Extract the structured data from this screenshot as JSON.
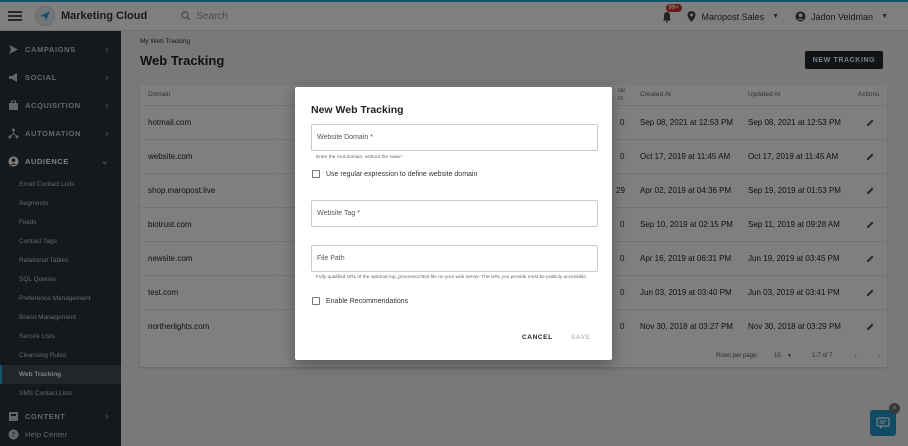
{
  "app": {
    "name": "Marketing Cloud"
  },
  "search": {
    "placeholder": "Search"
  },
  "header": {
    "notification_count": "99+",
    "account": "Maropost Sales",
    "user": "Jadon Veldman"
  },
  "sidebar": {
    "nav": [
      {
        "label": "CAMPAIGNS",
        "icon": "send-icon"
      },
      {
        "label": "SOCIAL",
        "icon": "megaphone-icon"
      },
      {
        "label": "ACQUISITION",
        "icon": "briefcase-icon"
      },
      {
        "label": "AUTOMATION",
        "icon": "flow-icon"
      },
      {
        "label": "AUDIENCE",
        "icon": "person-icon"
      }
    ],
    "audience_items": [
      "Email Contact Lists",
      "Segments",
      "Fields",
      "Contact Tags",
      "Relational Tables",
      "SQL Queries",
      "Preference Management",
      "Brand Management",
      "Secure Lists",
      "Cleansing Rules",
      "Web Tracking",
      "SMS Contact Lists"
    ],
    "active_item": "Web Tracking",
    "content_label": "CONTENT",
    "help_label": "Help Center"
  },
  "page": {
    "breadcrumb": "My Web Tracking",
    "title": "Web Tracking",
    "new_button": "NEW TRACKING"
  },
  "table": {
    "headers": {
      "domain": "Domain",
      "visitors": "tal\nrs",
      "created": "Created At",
      "updated": "Updated At",
      "actions": "Actions"
    },
    "rows": [
      {
        "domain": "hotmail.com",
        "count": "0",
        "created": "Sep 08, 2021 at 12:53 PM",
        "updated": "Sep 08, 2021 at 12:53 PM"
      },
      {
        "domain": "website.com",
        "count": "0",
        "created": "Oct 17, 2019 at 11:45 AM",
        "updated": "Oct 17, 2019 at 11:45 AM"
      },
      {
        "domain": "shop.maropost.live",
        "count": "29",
        "created": "Apr 02, 2019 at 04:36 PM",
        "updated": "Sep 19, 2019 at 01:53 PM"
      },
      {
        "domain": "biotrust.com",
        "count": "0",
        "created": "Sep 10, 2019 at 02:15 PM",
        "updated": "Sep 11, 2019 at 09:28 AM"
      },
      {
        "domain": "newsite.com",
        "count": "0",
        "created": "Apr 16, 2019 at 06:31 PM",
        "updated": "Jun 19, 2019 at 03:45 PM"
      },
      {
        "domain": "test.com",
        "count": "0",
        "created": "Jun 03, 2019 at 03:40 PM",
        "updated": "Jun 03, 2019 at 03:41 PM"
      },
      {
        "domain": "northerlights.com",
        "count": "0",
        "created": "Nov 30, 2018 at 03:27 PM",
        "updated": "Nov 30, 2018 at 03:29 PM"
      }
    ],
    "pager": {
      "rows_label": "Rows per page:",
      "rows_value": "10",
      "range": "1-7 of 7"
    }
  },
  "modal": {
    "title": "New Web Tracking",
    "domain_label": "Website Domain *",
    "domain_hint": "Enter the root domain, without the 'www.'",
    "regex_label": "Use regular expression to define website domain",
    "tag_label": "Website Tag *",
    "path_label": "File Path",
    "path_hint": "Fully qualified URL of the optional mp_processor.html file on your web server. The URL you provide must be publicly accessible.",
    "recommend_label": "Enable Recommendations",
    "cancel": "CANCEL",
    "save": "SAVE"
  }
}
